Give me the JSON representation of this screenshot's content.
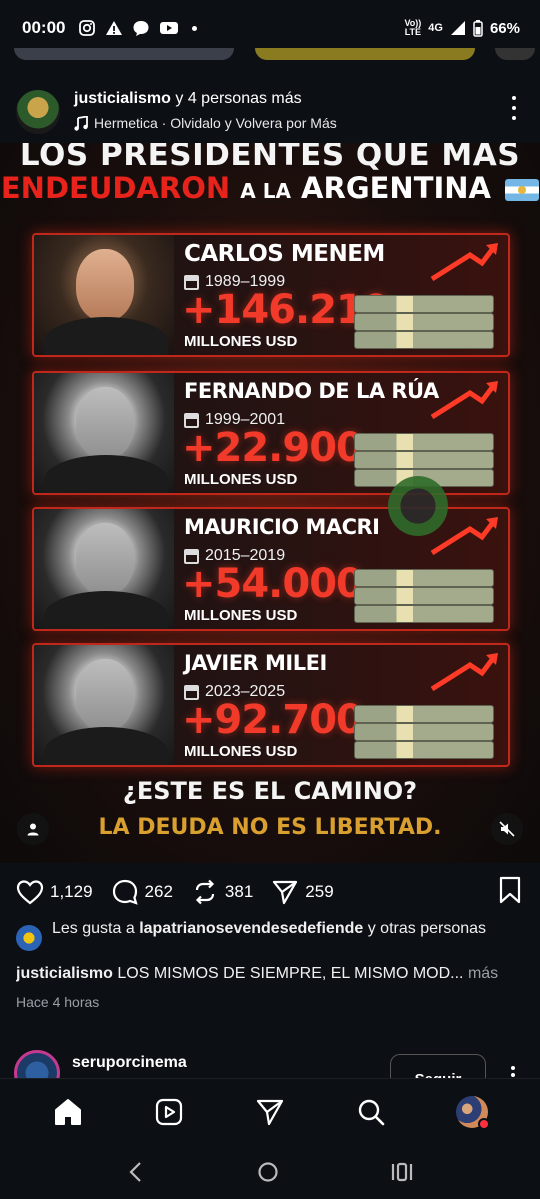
{
  "status_bar": {
    "time": "00:00",
    "network_top": "Vo))",
    "network_bottom": "LTE",
    "signal": "4G",
    "battery": "66%"
  },
  "post": {
    "author_line": "justicialismo",
    "author_suffix": "y 4 personas más",
    "music": "Hermetica · Olvidalo y Volvera por Más"
  },
  "poster": {
    "title_line1": "LOS PRESIDENTES QUE MÁS",
    "title_word1": "ENDEUDARON",
    "title_word2": "A LA",
    "title_word3": "ARGENTINA",
    "presidents": [
      {
        "name": "CARLOS MENEM",
        "years": "1989–1999",
        "amount": "+146.219",
        "unit": "MILLONES USD"
      },
      {
        "name": "FERNANDO DE LA RÚA",
        "years": "1999–2001",
        "amount": "+22.900",
        "unit": "MILLONES USD"
      },
      {
        "name": "MAURICIO MACRI",
        "years": "2015–2019",
        "amount": "+54.000",
        "unit": "MILLONES USD"
      },
      {
        "name": "JAVIER MILEI",
        "years": "2023–2025",
        "amount": "+92.700",
        "unit": "MILLONES USD"
      }
    ],
    "question": "¿ESTE ES EL CAMINO?",
    "tagline": "LA DEUDA NO ES LIBERTAD."
  },
  "actions": {
    "likes": "1,129",
    "comments": "262",
    "reposts": "381",
    "shares": "259"
  },
  "liked_by": {
    "prefix": "Les gusta a",
    "user": "lapatrianosevendesedefiende",
    "suffix": "y otras personas"
  },
  "caption": {
    "user": "justicialismo",
    "text": "LOS MISMOS DE SIEMPRE, EL MISMO MOD...",
    "more": "más"
  },
  "timestamp": "Hace 4 horas",
  "next_post": {
    "user": "seruporcinema",
    "follow_label": "Seguir"
  },
  "colors": {
    "accent_red": "#e8231c",
    "tagline_gold": "#d9a030",
    "background": "#0c0f14"
  }
}
